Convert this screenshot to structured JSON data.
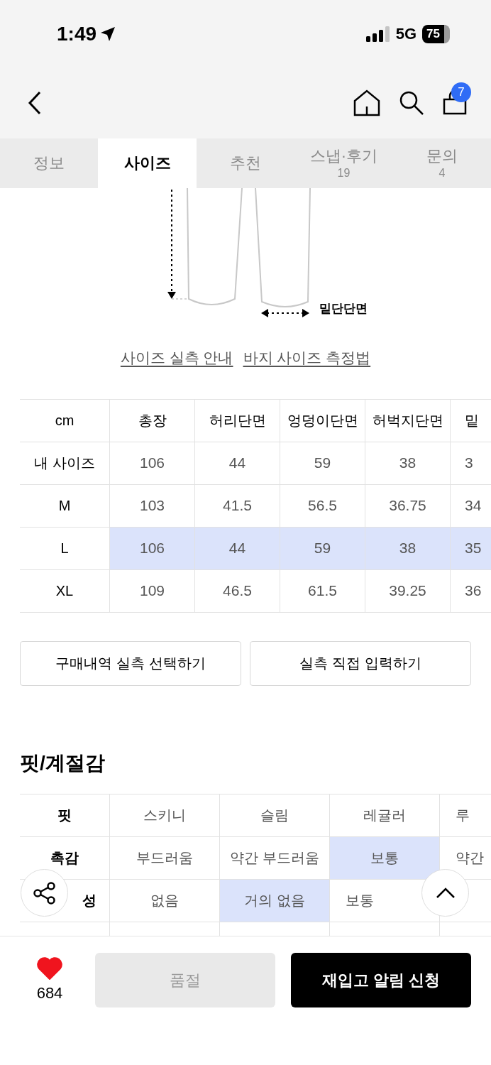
{
  "status_bar": {
    "time": "1:49",
    "network": "5G",
    "battery": "75"
  },
  "header": {
    "cart_count": "7"
  },
  "tabs": [
    {
      "label": "정보",
      "selected": false
    },
    {
      "label": "사이즈",
      "selected": true
    },
    {
      "label": "추천",
      "selected": false
    },
    {
      "label": "스냅·후기",
      "count": "19",
      "selected": false
    },
    {
      "label": "문의",
      "count": "4",
      "selected": false
    }
  ],
  "diagram": {
    "label": "밑단단면"
  },
  "links": [
    "사이즈 실측 안내",
    "바지 사이즈 측정법"
  ],
  "size_table": {
    "columns": [
      "cm",
      "총장",
      "허리단면",
      "엉덩이단면",
      "허벅지단면",
      "밑"
    ],
    "rows": [
      {
        "label": "내 사이즈",
        "values": [
          "106",
          "44",
          "59",
          "38",
          "3"
        ],
        "selected": false
      },
      {
        "label": "M",
        "values": [
          "103",
          "41.5",
          "56.5",
          "36.75",
          "34"
        ],
        "selected": false
      },
      {
        "label": "L",
        "values": [
          "106",
          "44",
          "59",
          "38",
          "35"
        ],
        "selected": true
      },
      {
        "label": "XL",
        "values": [
          "109",
          "46.5",
          "61.5",
          "39.25",
          "36"
        ],
        "selected": false
      }
    ]
  },
  "size_buttons": [
    "구매내역 실측 선택하기",
    "실측 직접 입력하기"
  ],
  "fit": {
    "title": "핏/계절감",
    "rows": [
      {
        "label": "핏",
        "options": [
          {
            "text": "스키니",
            "selected": false
          },
          {
            "text": "슬림",
            "selected": false
          },
          {
            "text": "레귤러",
            "selected": false
          },
          {
            "text": "루",
            "selected": false
          }
        ]
      },
      {
        "label": "촉감",
        "options": [
          {
            "text": "부드러움",
            "selected": false
          },
          {
            "text": "약간 부드러움",
            "selected": false
          },
          {
            "text": "보통",
            "selected": true
          },
          {
            "text": "약간",
            "selected": false
          }
        ]
      },
      {
        "label": "성",
        "options": [
          {
            "text": "없음",
            "selected": false
          },
          {
            "text": "거의 없음",
            "selected": true
          },
          {
            "text": "보통",
            "selected": false
          }
        ]
      }
    ]
  },
  "bottom_bar": {
    "likes": "684",
    "liked": true,
    "sold_out": "품절",
    "restock": "재입고 알림 신청"
  }
}
